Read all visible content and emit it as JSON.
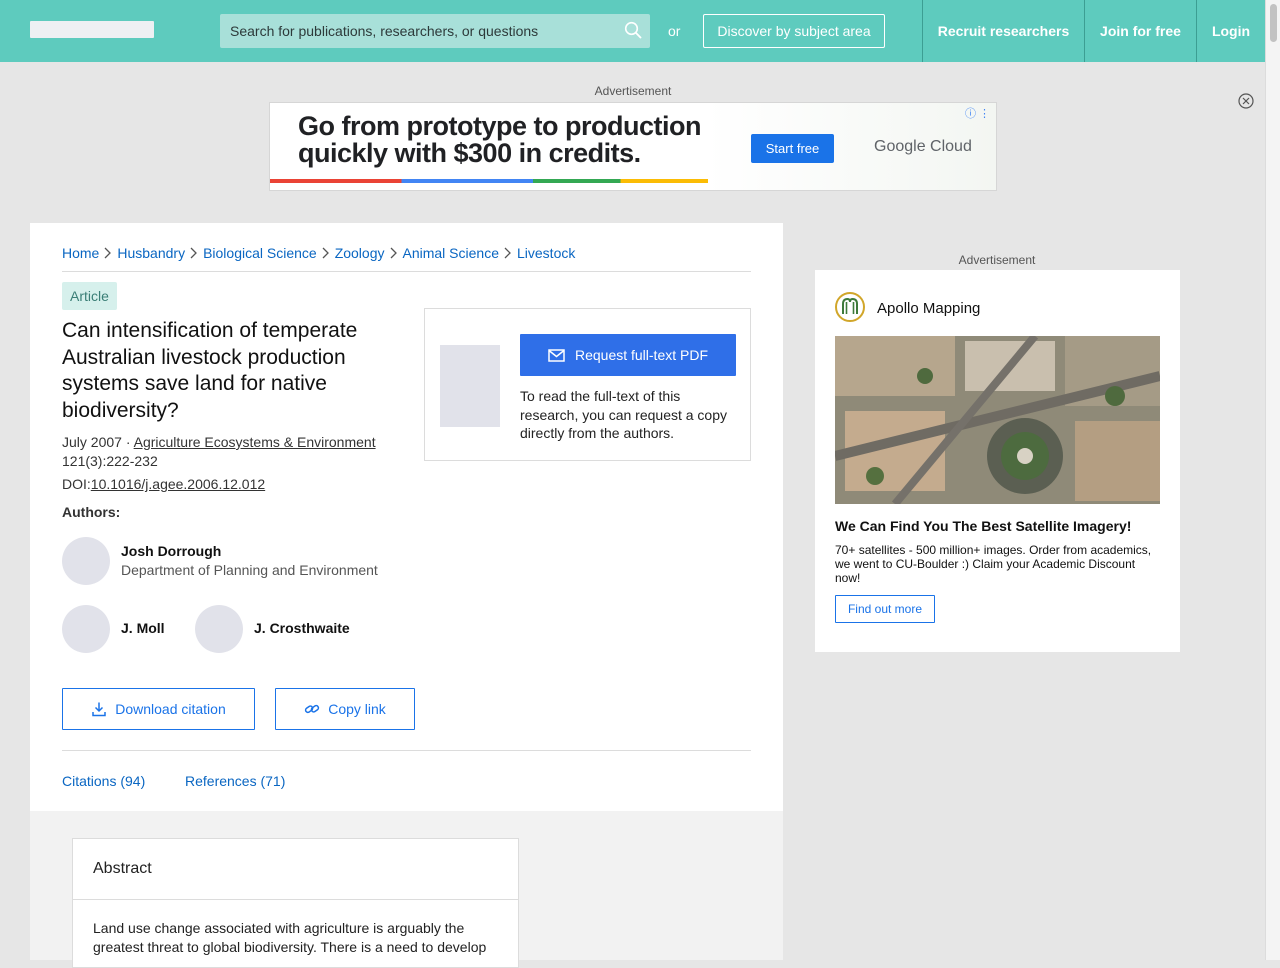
{
  "header": {
    "search_placeholder": "Search for publications, researchers, or questions",
    "or_text": "or",
    "discover_label": "Discover by subject area",
    "nav": {
      "recruit": "Recruit researchers",
      "join": "Join for free",
      "login": "Login"
    },
    "accent_color": "#5ecbbe"
  },
  "top_ad": {
    "label": "Advertisement",
    "headline": "Go from prototype to production quickly with $300 in credits.",
    "cta": "Start free",
    "brand_google": "Google",
    "brand_cloud": " Cloud",
    "info_icon": "info-icon"
  },
  "breadcrumb": [
    "Home",
    "Husbandry",
    "Biological Science",
    "Zoology",
    "Animal Science",
    "Livestock"
  ],
  "article": {
    "type": "Article",
    "title": "Can intensification of temperate Australian livestock production systems save land for native biodiversity?",
    "date": "July 2007 · ",
    "journal": "Agriculture Ecosystems & Environment",
    "volume": "121(3):222-232",
    "doi_label": "DOI:",
    "doi": "10.1016/j.agee.2006.12.012",
    "authors_label": "Authors:",
    "authors": [
      {
        "name": "Josh Dorrough",
        "dept": "Department of Planning and Environment"
      },
      {
        "name": "J. Moll"
      },
      {
        "name": "J. Crosthwaite"
      }
    ],
    "download_citation": "Download citation",
    "copy_link": "Copy link",
    "tabs": {
      "citations": "Citations (94)",
      "references": "References (71)"
    }
  },
  "pdf_box": {
    "button": "Request full-text PDF",
    "text": "To read the full-text of this research, you can request a copy directly from the authors."
  },
  "abstract": {
    "title": "Abstract",
    "text": "Land use change associated with agriculture is arguably the greatest threat to global biodiversity. There is a need to develop"
  },
  "side_ad": {
    "label": "Advertisement",
    "brand": "Apollo Mapping",
    "headline": "We Can Find You The Best Satellite Imagery!",
    "body": "70+ satellites - 500 million+ images. Order from academics, we went to CU-Boulder :) Claim your Academic Discount now!",
    "cta": "Find out more"
  }
}
